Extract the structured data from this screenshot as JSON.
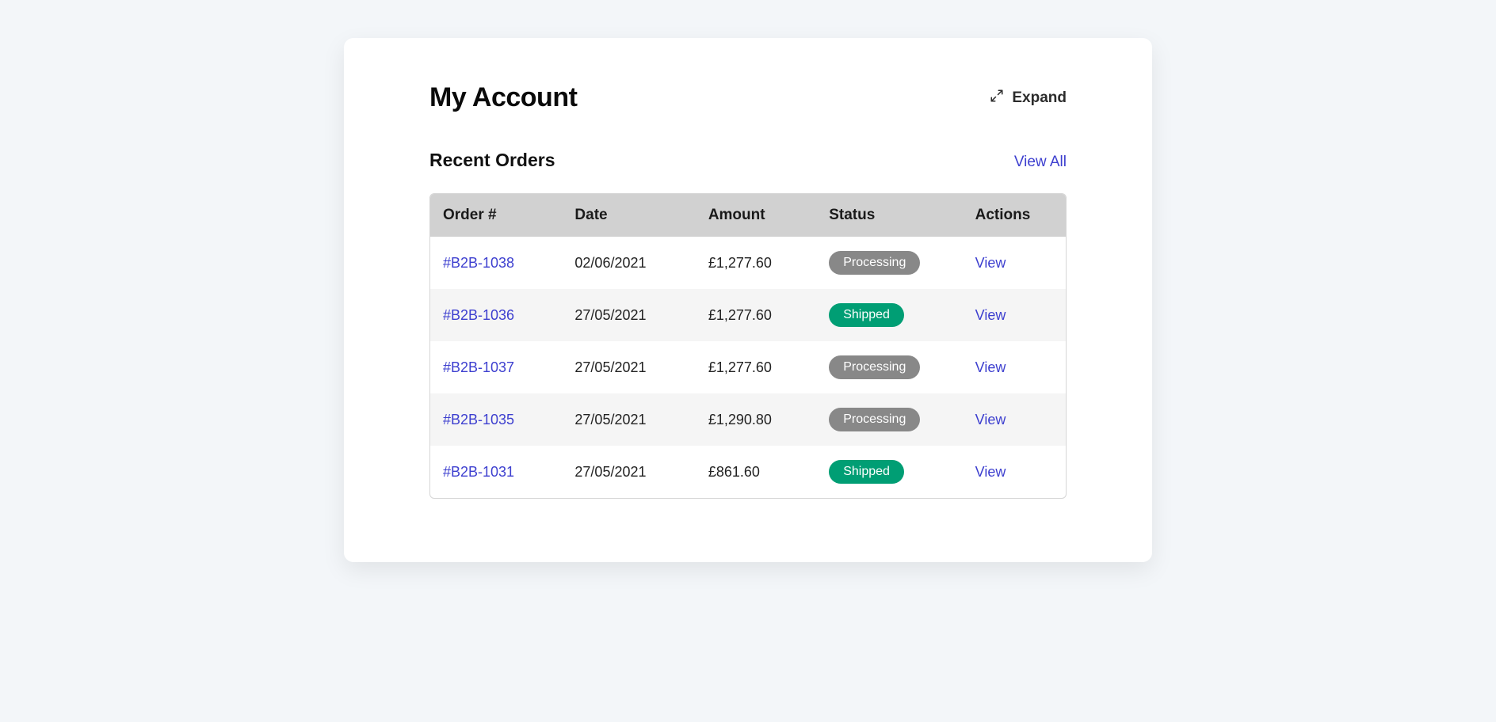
{
  "header": {
    "title": "My Account",
    "expand_label": "Expand"
  },
  "section": {
    "title": "Recent Orders",
    "view_all_label": "View All"
  },
  "table": {
    "columns": [
      "Order #",
      "Date",
      "Amount",
      "Status",
      "Actions"
    ],
    "action_label": "View",
    "rows": [
      {
        "order": "#B2B-1038",
        "date": "02/06/2021",
        "amount": "£1,277.60",
        "status": "Processing",
        "status_kind": "processing"
      },
      {
        "order": "#B2B-1036",
        "date": "27/05/2021",
        "amount": "£1,277.60",
        "status": "Shipped",
        "status_kind": "shipped"
      },
      {
        "order": "#B2B-1037",
        "date": "27/05/2021",
        "amount": "£1,277.60",
        "status": "Processing",
        "status_kind": "processing"
      },
      {
        "order": "#B2B-1035",
        "date": "27/05/2021",
        "amount": "£1,290.80",
        "status": "Processing",
        "status_kind": "processing"
      },
      {
        "order": "#B2B-1031",
        "date": "27/05/2021",
        "amount": "£861.60",
        "status": "Shipped",
        "status_kind": "shipped"
      }
    ]
  }
}
